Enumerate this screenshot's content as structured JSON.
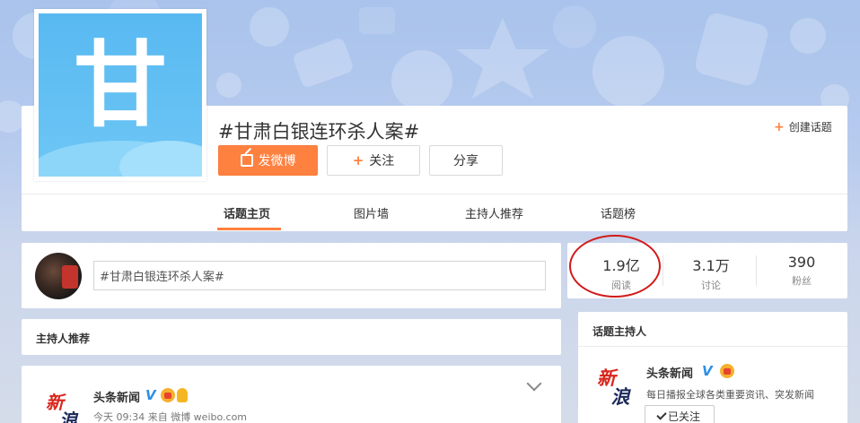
{
  "topic": {
    "avatar_char": "甘",
    "title": "#甘肃白银连环杀人案#",
    "create_label": "创建话题"
  },
  "actions": {
    "post_label": "发微博",
    "follow_label": "关注",
    "share_label": "分享"
  },
  "tabs": [
    {
      "label": "话题主页",
      "active": true
    },
    {
      "label": "图片墙",
      "active": false
    },
    {
      "label": "主持人推荐",
      "active": false
    },
    {
      "label": "话题榜",
      "active": false
    }
  ],
  "composer": {
    "value": "#甘肃白银连环杀人案#"
  },
  "host_recommend": {
    "title": "主持人推荐"
  },
  "feed_item": {
    "logo_chars": "新浪",
    "name": "头条新闻",
    "meta": "今天 09:34 来自 微博 weibo.com"
  },
  "stats": [
    {
      "value": "1.9亿",
      "label": "阅读"
    },
    {
      "value": "3.1万",
      "label": "讨论"
    },
    {
      "value": "390",
      "label": "粉丝"
    }
  ],
  "hosts": {
    "title": "话题主持人",
    "name": "头条新闻",
    "desc": "每日播报全球各类重要资讯、突发新闻",
    "followed_label": "已关注"
  },
  "colors": {
    "accent": "#ff8140",
    "verify_blue": "#2b8fe6",
    "highlight_circle": "#d11a1a"
  }
}
